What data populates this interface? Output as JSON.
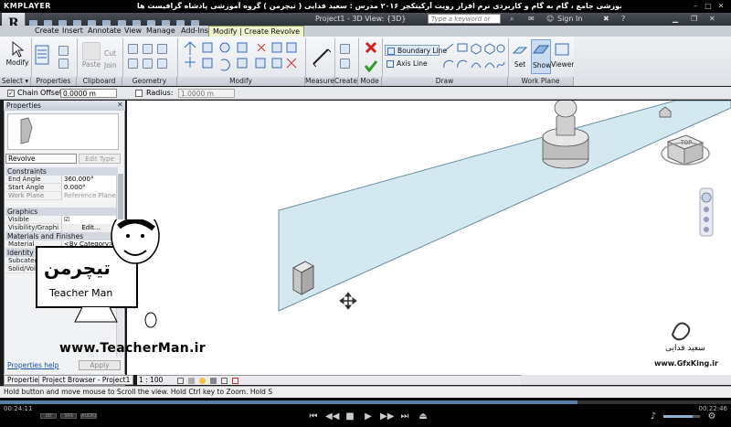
{
  "player": {
    "brand": "KMPLAYER",
    "title": "مجموعه آموزشی جامع ، گام به گام و کاربردی نرم افزار رویت آرکیتکچر ۲۰۱۶   مدرس : سعید فدایی ( تیچرمن ) گروه آموزشی پادشاه گرافیست ها",
    "time_elapsed": "00:24:11",
    "time_total": "00:22:46",
    "progress": 0.79,
    "volume": 0.8,
    "mini_labels": [
      "3D",
      "SRS",
      "AUDIO"
    ]
  },
  "app": {
    "doc_title": "Project1 - 3D View: {3D}",
    "search_placeholder": "Type a keyword or phrase",
    "sign_in": "Sign In",
    "help": "?"
  },
  "tabs": [
    "Create",
    "Insert",
    "Annotate",
    "View",
    "Manage",
    "Add-Ins",
    "Modify | Create Revolve"
  ],
  "active_tab": "Modify | Create Revolve",
  "ribbon": {
    "select": {
      "modify": "Modify",
      "label": "Select ▾"
    },
    "properties": {
      "label": "Properties"
    },
    "clipboard": {
      "paste": "Paste",
      "cut_label": "Cut",
      "join_label": "Join",
      "label": "Clipboard"
    },
    "geometry": {
      "label": "Geometry"
    },
    "modify": {
      "label": "Modify"
    },
    "measure": {
      "label": "Measure"
    },
    "create": {
      "label": "Create"
    },
    "mode": {
      "label": "Mode"
    },
    "draw": {
      "boundary_line": "Boundary Line",
      "axis_line": "Axis Line",
      "label": "Draw"
    },
    "work_plane": {
      "set": "Set",
      "show": "Show",
      "viewer": "Viewer",
      "label": "Work Plane"
    }
  },
  "options_bar": {
    "chain_label": "Chain",
    "chain_checked": true,
    "offset_label": "Offset:",
    "offset_value": "0.0000 m",
    "radius_label": "Radius:",
    "radius_value": "1.0000 m"
  },
  "properties": {
    "header": "Properties",
    "type": "Revolve",
    "edit_type": "Edit Type",
    "sections": [
      {
        "name": "Constraints",
        "rows": [
          {
            "k": "End Angle",
            "v": "360.000°",
            "dim": false
          },
          {
            "k": "Start Angle",
            "v": "0.000°",
            "dim": false
          },
          {
            "k": "Work Plane",
            "v": "Reference Plane",
            "dim": true
          }
        ]
      },
      {
        "name": "Graphics",
        "rows": [
          {
            "k": "Visible",
            "v": "☑",
            "dim": false
          },
          {
            "k": "Visibility/Graphi...",
            "v": "Edit...",
            "dim": false
          }
        ]
      },
      {
        "name": "Materials and Finishes",
        "rows": [
          {
            "k": "Material",
            "v": "<By Category>",
            "dim": false
          }
        ]
      },
      {
        "name": "Identity Data",
        "rows": [
          {
            "k": "Subcategory",
            "v": "",
            "dim": false
          },
          {
            "k": "Solid/Void",
            "v": "",
            "dim": false
          }
        ]
      }
    ],
    "help": "Properties help",
    "apply": "Apply",
    "tab_properties": "Properties",
    "tab_browser": "Project Browser - Project1"
  },
  "view_control": {
    "scale": "1 : 100"
  },
  "status": "Hold button and move mouse to Scroll the view. Hold Ctrl key to Zoom. Hold S",
  "overlay": {
    "teacher_url": "www.TeacherMan.ir",
    "teacher_name": "Teacher Man",
    "teacher_logo": "تیچرمن",
    "gfx_url": "www.GfxKing.ir",
    "gfx_fa": "سعید فدایی"
  },
  "viewcube_label": "TOP"
}
